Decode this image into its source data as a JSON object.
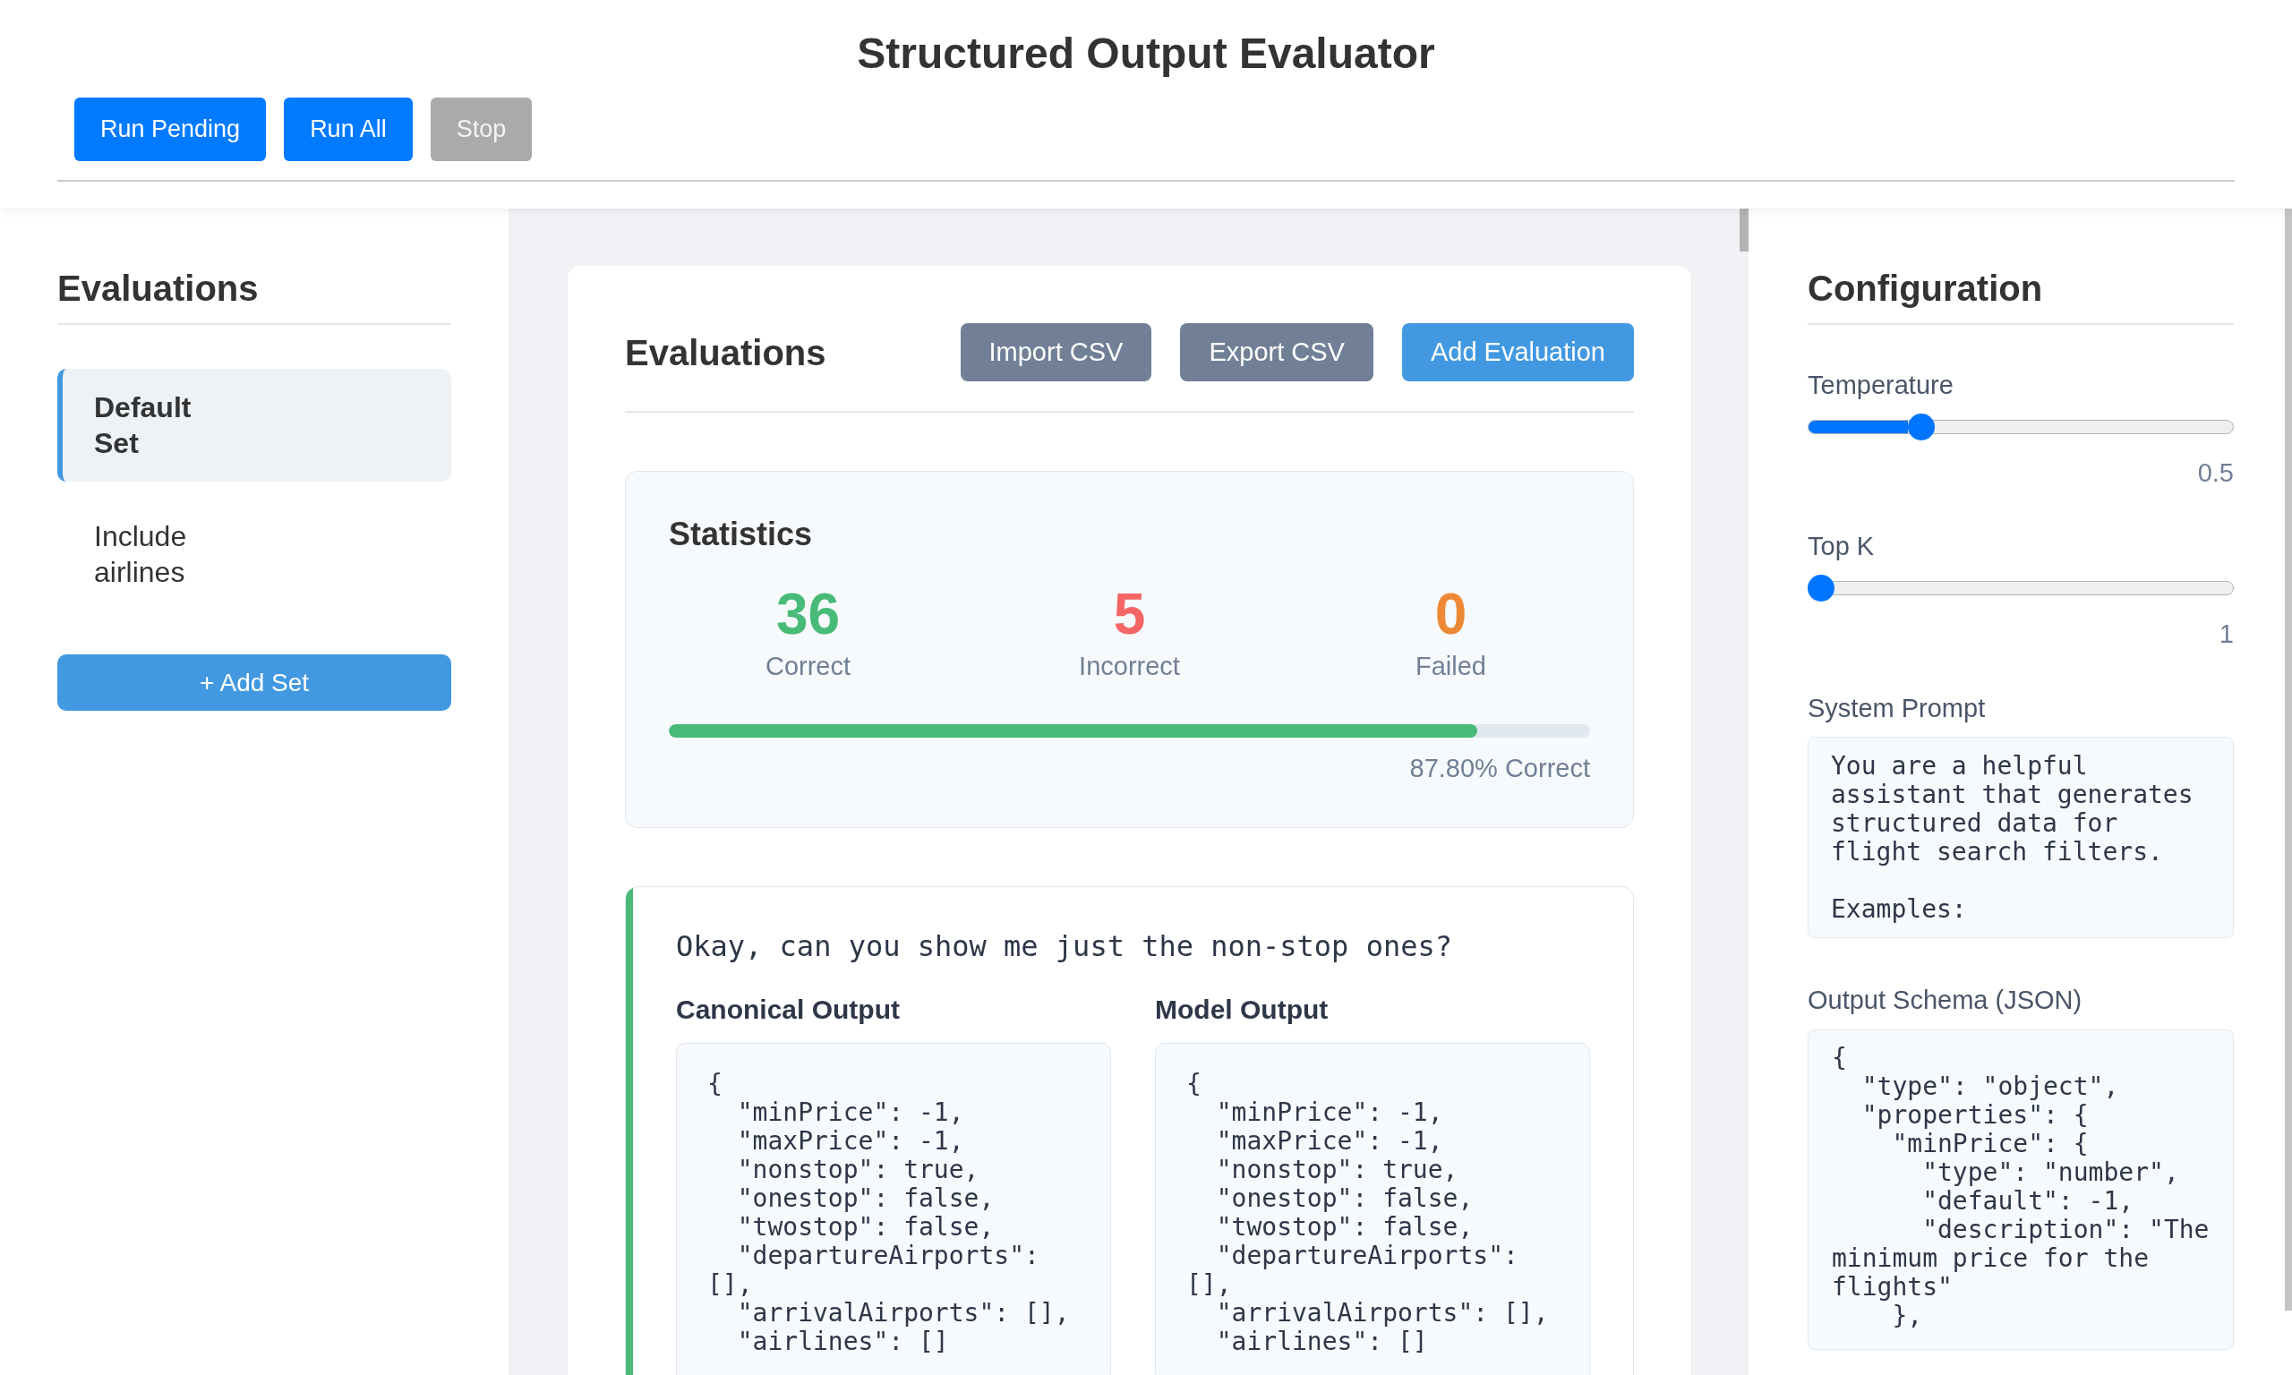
{
  "header": {
    "title": "Structured Output Evaluator",
    "buttons": [
      {
        "label": "Run Pending",
        "disabled": false
      },
      {
        "label": "Run All",
        "disabled": false
      },
      {
        "label": "Stop",
        "disabled": true
      }
    ]
  },
  "sidebar": {
    "title": "Evaluations",
    "sets": [
      {
        "name": "Default Set",
        "selected": true
      },
      {
        "name": "Include airlines",
        "selected": false
      }
    ],
    "add_button": "+ Add Set"
  },
  "main": {
    "title": "Evaluations",
    "buttons": [
      {
        "label": "Import CSV",
        "kind": "secondary"
      },
      {
        "label": "Export CSV",
        "kind": "secondary"
      },
      {
        "label": "Add Evaluation",
        "kind": "primary"
      }
    ],
    "statistics": {
      "title": "Statistics",
      "items": [
        {
          "value": "36",
          "label": "Correct",
          "color": "#48bb78"
        },
        {
          "value": "5",
          "label": "Incorrect",
          "color": "#f56565"
        },
        {
          "value": "0",
          "label": "Failed",
          "color": "#ed8936"
        }
      ],
      "progress": {
        "level": 0.878,
        "reading": "87.80% Correct"
      }
    },
    "evaluations": [
      {
        "color": "#48bb78",
        "query": "Okay, can you show me just the non-stop ones?",
        "outputs": [
          {
            "title": "Canonical Output",
            "code": "{\n  \"minPrice\": -1,\n  \"maxPrice\": -1,\n  \"nonstop\": true,\n  \"onestop\": false,\n  \"twostop\": false,\n  \"departureAirports\": [],\n  \"arrivalAirports\": [],\n  \"airlines\": []"
          },
          {
            "title": "Model Output",
            "code": "{\n  \"minPrice\": -1,\n  \"maxPrice\": -1,\n  \"nonstop\": true,\n  \"onestop\": false,\n  \"twostop\": false,\n  \"departureAirports\": [],\n  \"arrivalAirports\": [],\n  \"airlines\": []"
          }
        ]
      }
    ]
  },
  "configuration": {
    "title": "Configuration",
    "sliders": [
      {
        "label": "Temperature",
        "level": 0.25,
        "reading": "0.5"
      },
      {
        "label": "Top K",
        "level": 0,
        "reading": "1"
      }
    ],
    "fields": [
      {
        "label": "System Prompt",
        "value": "You are a helpful assistant that generates structured data for flight search filters.\n\nExamples:"
      },
      {
        "label": "Output Schema (JSON)",
        "value": "{\n  \"type\": \"object\",\n  \"properties\": {\n    \"minPrice\": {\n      \"type\": \"number\",\n      \"default\": -1,\n      \"description\": \"The minimum price for the flights\"\n    },"
      }
    ]
  }
}
